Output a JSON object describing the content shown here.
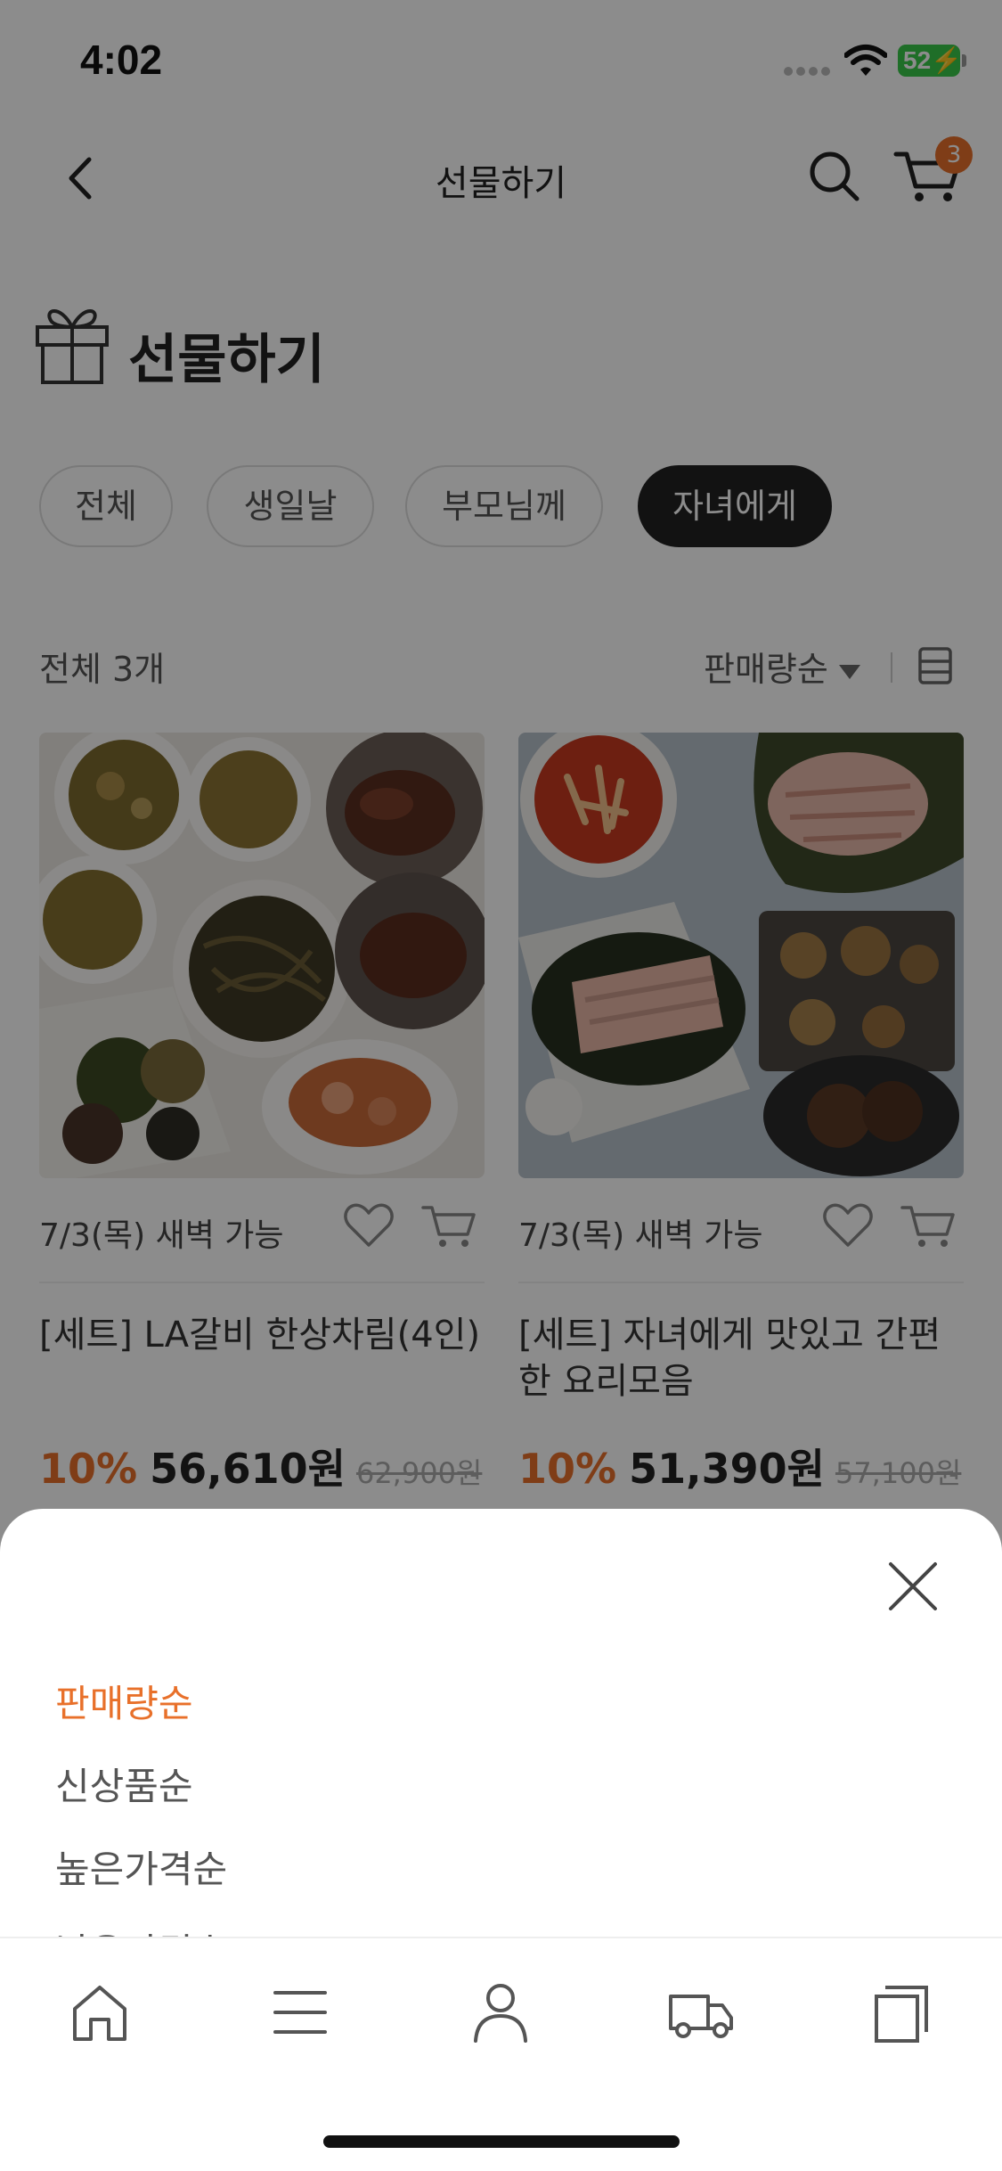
{
  "status_bar": {
    "time": "4:02",
    "battery": "52"
  },
  "header": {
    "title": "선물하기",
    "cart_count": "3"
  },
  "page": {
    "heading": "선물하기",
    "chips": [
      "전체",
      "생일날",
      "부모님께",
      "자녀에게"
    ],
    "active_chip": "자녀에게",
    "count_label": "전체 3개",
    "sort_label": "판매량순"
  },
  "products": [
    {
      "delivery": "7/3(목) 새벽 가능",
      "name": "[세트] LA갈비 한상차림(4인)",
      "discount": "10%",
      "price": "56,610원",
      "original_price": "62,900원"
    },
    {
      "delivery": "7/3(목) 새벽 가능",
      "name": "[세트] 자녀에게 맛있고 간편한 요리모음",
      "discount": "10%",
      "price": "51,390원",
      "original_price": "57,100원"
    }
  ],
  "sort_sheet": {
    "options": [
      "판매량순",
      "신상품순",
      "높은가격순",
      "낮은가격순"
    ],
    "selected": "판매량순"
  },
  "tab_bar": {
    "tabs": [
      "home-icon",
      "menu-icon",
      "person-icon",
      "truck-icon",
      "recent-icon"
    ]
  },
  "colors": {
    "accent": "#e8702a",
    "chip_active": "#222222"
  }
}
